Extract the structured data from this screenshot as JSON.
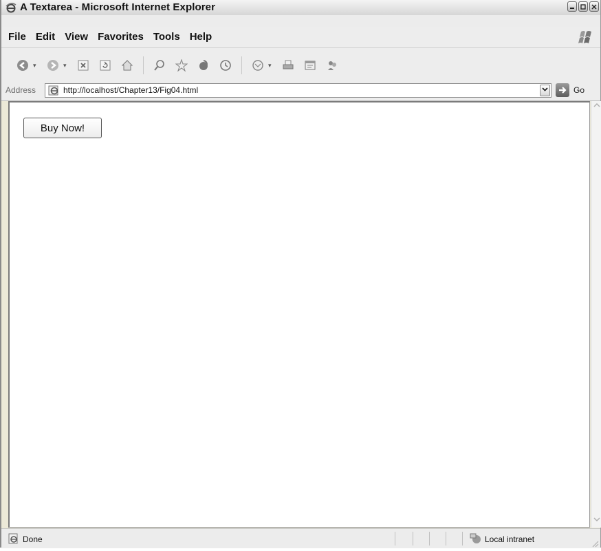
{
  "window": {
    "title": "A Textarea - Microsoft Internet Explorer",
    "controls": [
      "minimize",
      "maximize",
      "close"
    ]
  },
  "menubar": {
    "items": [
      "File",
      "Edit",
      "View",
      "Favorites",
      "Tools",
      "Help"
    ]
  },
  "toolbar": {
    "icons": [
      "back-icon",
      "forward-icon",
      "stop-icon",
      "refresh-icon",
      "home-icon",
      "search-icon",
      "favorites-icon",
      "media-icon",
      "history-icon",
      "mail-icon",
      "print-icon",
      "edit-icon",
      "messenger-icon"
    ]
  },
  "addressbar": {
    "label": "Address",
    "url": "http://localhost/Chapter13/Fig04.html",
    "go_label": "Go"
  },
  "content": {
    "button_label": "Buy Now!"
  },
  "statusbar": {
    "status": "Done",
    "zone": "Local intranet"
  }
}
